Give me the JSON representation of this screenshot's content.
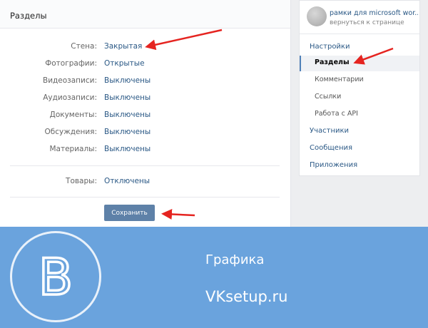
{
  "main": {
    "header_title": "Разделы",
    "sections": [
      {
        "label": "Стена:",
        "value": "Закрытая"
      },
      {
        "label": "Фотографии:",
        "value": "Открытые"
      },
      {
        "label": "Видеозаписи:",
        "value": "Выключены"
      },
      {
        "label": "Аудиозаписи:",
        "value": "Выключены"
      },
      {
        "label": "Документы:",
        "value": "Выключены"
      },
      {
        "label": "Обсуждения:",
        "value": "Выключены"
      },
      {
        "label": "Материалы:",
        "value": "Выключены"
      }
    ],
    "products": {
      "label": "Товары:",
      "value": "Отключены"
    },
    "save_label": "Сохранить"
  },
  "nav": {
    "group_name": "рамки для microsoft wor...",
    "group_back": "вернуться к странице",
    "items": [
      {
        "label": "Настройки"
      },
      {
        "label": "Разделы"
      },
      {
        "label": "Комментарии"
      },
      {
        "label": "Ссылки"
      },
      {
        "label": "Работа с API"
      },
      {
        "label": "Участники"
      },
      {
        "label": "Сообщения"
      },
      {
        "label": "Приложения"
      }
    ]
  },
  "banner": {
    "title": "Графика",
    "site": "VKsetup.ru",
    "logo_letter": "B"
  },
  "colors": {
    "link": "#2a5885",
    "button": "#5e81a8",
    "banner": "#6aa3dd",
    "annotation_arrow": "#e52420"
  },
  "icons": [
    "group-avatar",
    "vk-logo",
    "annotation-arrow"
  ]
}
